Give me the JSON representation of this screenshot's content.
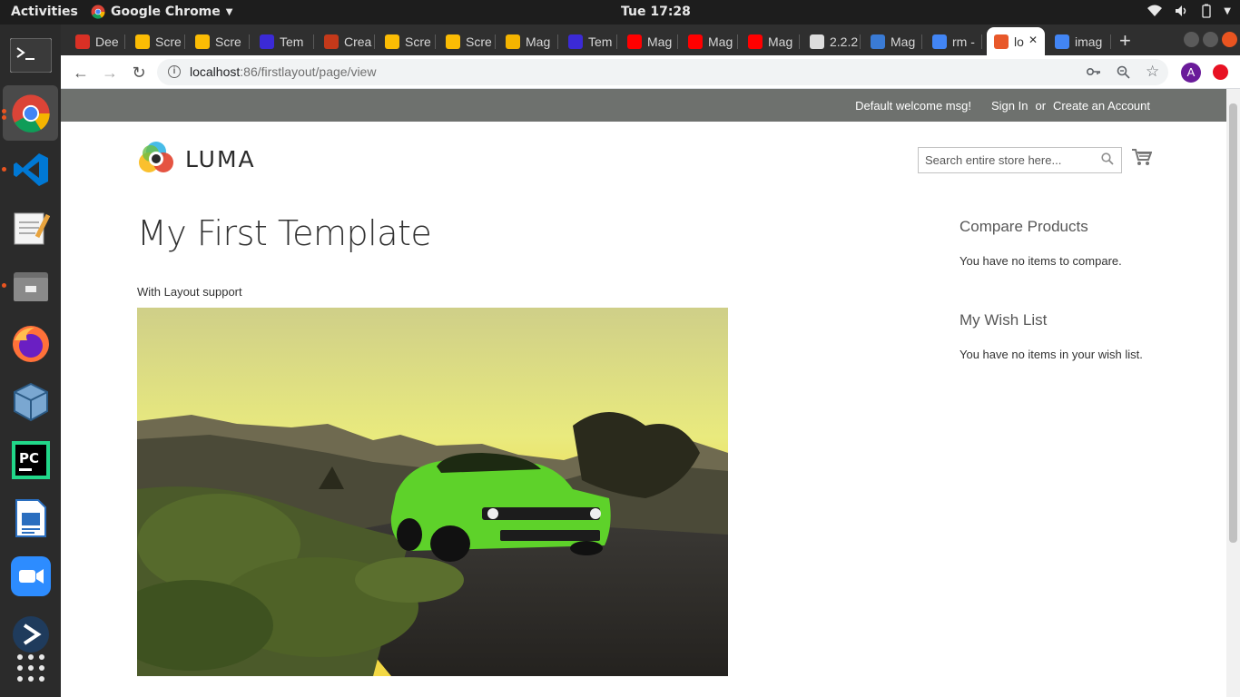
{
  "os": {
    "activities": "Activities",
    "app_menu": "Google Chrome",
    "clock": "Tue 17:28"
  },
  "tabs": [
    {
      "label": "Dee",
      "icon": "gmail-icon",
      "color": "#d93025"
    },
    {
      "label": "Scre",
      "icon": "photos-icon",
      "color": "#fbbc04"
    },
    {
      "label": "Scre",
      "icon": "photos-icon",
      "color": "#fbbc04"
    },
    {
      "label": "Tem",
      "icon": "php-icon",
      "color": "#3b2ad6"
    },
    {
      "label": "Crea",
      "icon": "magento-icon",
      "color": "#c4391a"
    },
    {
      "label": "Scre",
      "icon": "photos-icon",
      "color": "#fbbc04"
    },
    {
      "label": "Scre",
      "icon": "photos-icon",
      "color": "#fbbc04"
    },
    {
      "label": "Mag",
      "icon": "slides-icon",
      "color": "#f4b400"
    },
    {
      "label": "Tem",
      "icon": "php-icon",
      "color": "#3b2ad6"
    },
    {
      "label": "Mag",
      "icon": "youtube-icon",
      "color": "#ff0000"
    },
    {
      "label": "Mag",
      "icon": "youtube-icon",
      "color": "#ff0000"
    },
    {
      "label": "Mag",
      "icon": "youtube-icon",
      "color": "#ff0000"
    },
    {
      "label": "2.2.2",
      "icon": "github-icon",
      "color": "#dddddd"
    },
    {
      "label": "Mag",
      "icon": "site-icon",
      "color": "#3a7bd5"
    },
    {
      "label": "rm -",
      "icon": "google-icon",
      "color": "#4285f4"
    },
    {
      "label": "lo",
      "icon": "magento-icon",
      "color": "#e8582a"
    },
    {
      "label": "imag",
      "icon": "google-icon",
      "color": "#4285f4"
    }
  ],
  "toolbar": {
    "url_host": "localhost",
    "url_rest": ":86/firstlayout/page/view"
  },
  "header": {
    "welcome": "Default welcome msg!",
    "sign_in": "Sign In",
    "or": "or",
    "create_account": "Create an Account"
  },
  "logo": {
    "text": "LUMA"
  },
  "search": {
    "placeholder": "Search entire store here..."
  },
  "main": {
    "title": "My First Template",
    "subtitle": "With Layout support"
  },
  "sidebar": {
    "compare_title": "Compare Products",
    "compare_text": "You have no items to compare.",
    "wishlist_title": "My Wish List",
    "wishlist_text": "You have no items in your wish list."
  },
  "profile": {
    "initial": "A"
  },
  "colors": {
    "header_bar": "#6e716e",
    "profile": "#6a1b9a"
  }
}
